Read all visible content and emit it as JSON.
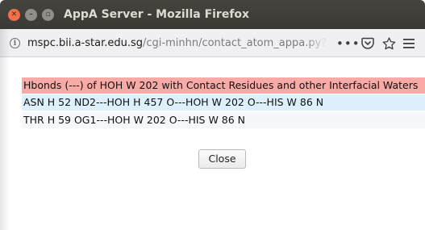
{
  "window": {
    "title": "AppA Server - Mozilla Firefox",
    "close_icon": "close-icon",
    "minimize_icon": "minimize-icon",
    "maximize_icon": "maximize-icon"
  },
  "navbar": {
    "url_domain": "mspc.bii.a-star.edu.sg",
    "url_path": "/cgi-minhn/contact_atom_appa.py?file",
    "icons": [
      "info-icon",
      "more-icon",
      "pocket-icon",
      "star-icon",
      "menu-icon"
    ]
  },
  "content": {
    "header": "Hbonds (---) of HOH W 202 with Contact Residues and other Interfacial Waters",
    "rows": [
      "ASN H 52 ND2---HOH H 457 O---HOH W 202 O---HIS W 86 N",
      "THR H 59 OG1---HOH W 202 O---HIS W 86 N"
    ],
    "close_label": "Close"
  },
  "colors": {
    "header_bg": "#f7aaa6",
    "row1_bg": "#def0fb",
    "row2_bg": "#f5f8fa",
    "titlebar_bg": "#3f3e3a",
    "close_button_accent": "#f0714b"
  }
}
